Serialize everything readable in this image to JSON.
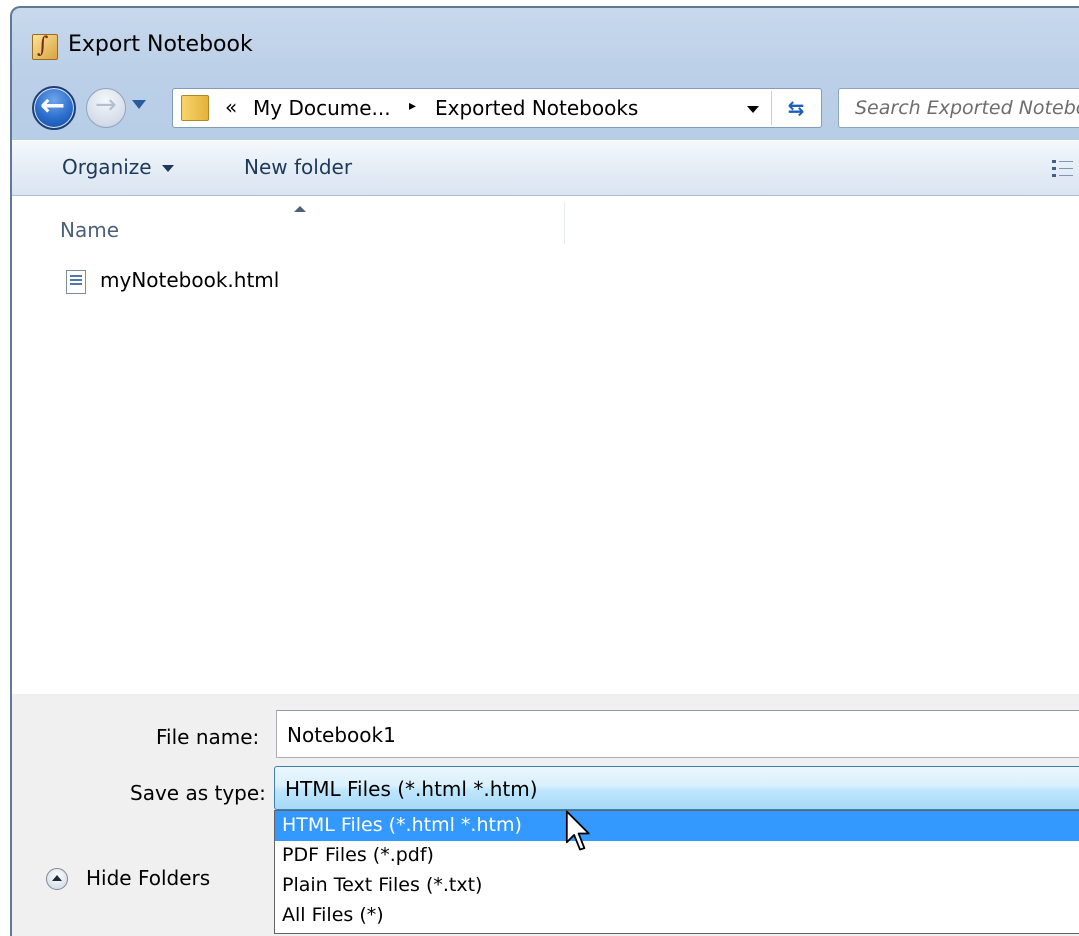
{
  "window": {
    "title": "Export Notebook"
  },
  "navigation": {
    "back_icon": "back-arrow-icon",
    "forward_icon": "forward-arrow-icon",
    "address": {
      "overflow_glyph": "«",
      "segments": [
        "My Docume...",
        "Exported Notebooks"
      ],
      "separator_glyph": "▸"
    },
    "refresh_glyph": "⇆",
    "search": {
      "placeholder": "Search Exported Notebooks"
    }
  },
  "command_bar": {
    "organize_label": "Organize",
    "new_folder_label": "New folder"
  },
  "file_list": {
    "column_name": "Name",
    "files": [
      {
        "name": "myNotebook.html",
        "icon": "html-file-icon"
      }
    ]
  },
  "form": {
    "file_name_label": "File name:",
    "file_name_value": "Notebook1",
    "save_type_label": "Save as type:",
    "save_type_value": "HTML Files (*.html *.htm)",
    "save_type_options": [
      "HTML Files (*.html *.htm)",
      "PDF Files (*.pdf)",
      "Plain Text Files (*.txt)",
      "All Files (*)"
    ],
    "selected_option_index": 0
  },
  "footer": {
    "hide_folders_label": "Hide Folders"
  },
  "colors": {
    "selection": "#3399ff",
    "titlebar": "#bcd0e8",
    "command_bar": "#e5edf6",
    "bottom_panel": "#f0f0f0"
  }
}
